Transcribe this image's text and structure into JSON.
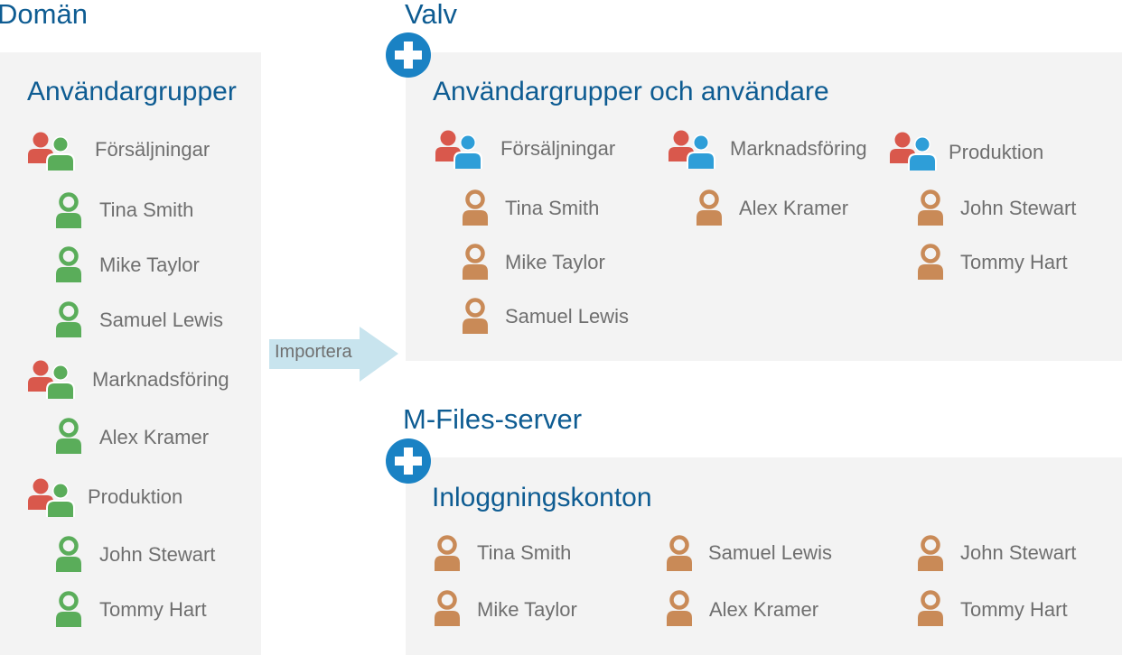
{
  "domain": {
    "heading": "Domän",
    "title": "Användargrupper",
    "groups": [
      {
        "label": "Försäljningar",
        "users": [
          "Tina Smith",
          "Mike Taylor",
          "Samuel Lewis"
        ]
      },
      {
        "label": "Marknadsföring",
        "users": [
          "Alex Kramer"
        ]
      },
      {
        "label": "Produktion",
        "users": [
          "John Stewart",
          "Tommy Hart"
        ]
      }
    ]
  },
  "import_label": "Importera",
  "vault": {
    "heading": "Valv",
    "title": "Användargrupper och användare",
    "groups": [
      {
        "label": "Försäljningar",
        "users": [
          "Tina Smith",
          "Mike Taylor",
          "Samuel Lewis"
        ]
      },
      {
        "label": "Marknadsföring",
        "users": [
          "Alex Kramer"
        ]
      },
      {
        "label": "Produktion",
        "users": [
          "John Stewart",
          "Tommy Hart"
        ]
      }
    ]
  },
  "server": {
    "heading": "M-Files-server",
    "title": "Inloggningskonton",
    "accounts": [
      [
        "Tina Smith",
        "Mike Taylor"
      ],
      [
        "Samuel Lewis",
        "Alex Kramer"
      ],
      [
        "John Stewart",
        "Tommy Hart"
      ]
    ]
  },
  "colors": {
    "heading_blue": "#0e5c92",
    "plus_blue": "#1a82c4",
    "panel_gray": "#f3f3f3",
    "user_green": "#5aad5a",
    "user_orange": "#c98a57",
    "group_red": "#d9584c",
    "group_blue": "#2e9ed8",
    "arrow_light_blue": "#c8e4ee",
    "text_gray": "#6f6f6f"
  },
  "icons": {
    "group": "group-icon",
    "user": "user-icon",
    "add": "plus-circle-icon",
    "arrow": "right-arrow-icon"
  }
}
